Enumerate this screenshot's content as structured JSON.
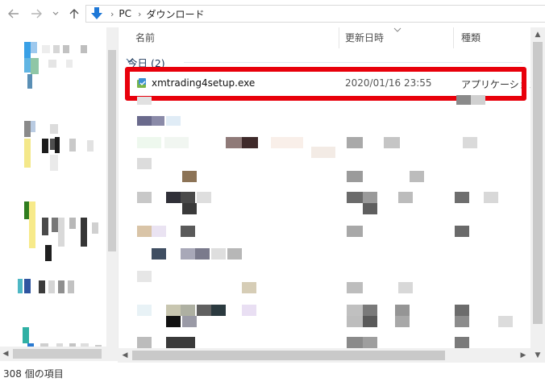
{
  "address_bar": {
    "path": [
      "PC",
      "ダウンロード"
    ]
  },
  "columns": {
    "name": "名前",
    "date_modified": "更新日時",
    "type": "種類"
  },
  "group": {
    "label": "今日 (2)"
  },
  "file": {
    "name": "xmtrading4setup.exe",
    "date": "2020/01/16 23:55",
    "type": "アプリケーション",
    "icon": "installer-icon"
  },
  "status": {
    "item_count": "308 個の項目"
  },
  "colors": {
    "highlight": "#e8000b",
    "address_accent": "#1e78d7"
  }
}
